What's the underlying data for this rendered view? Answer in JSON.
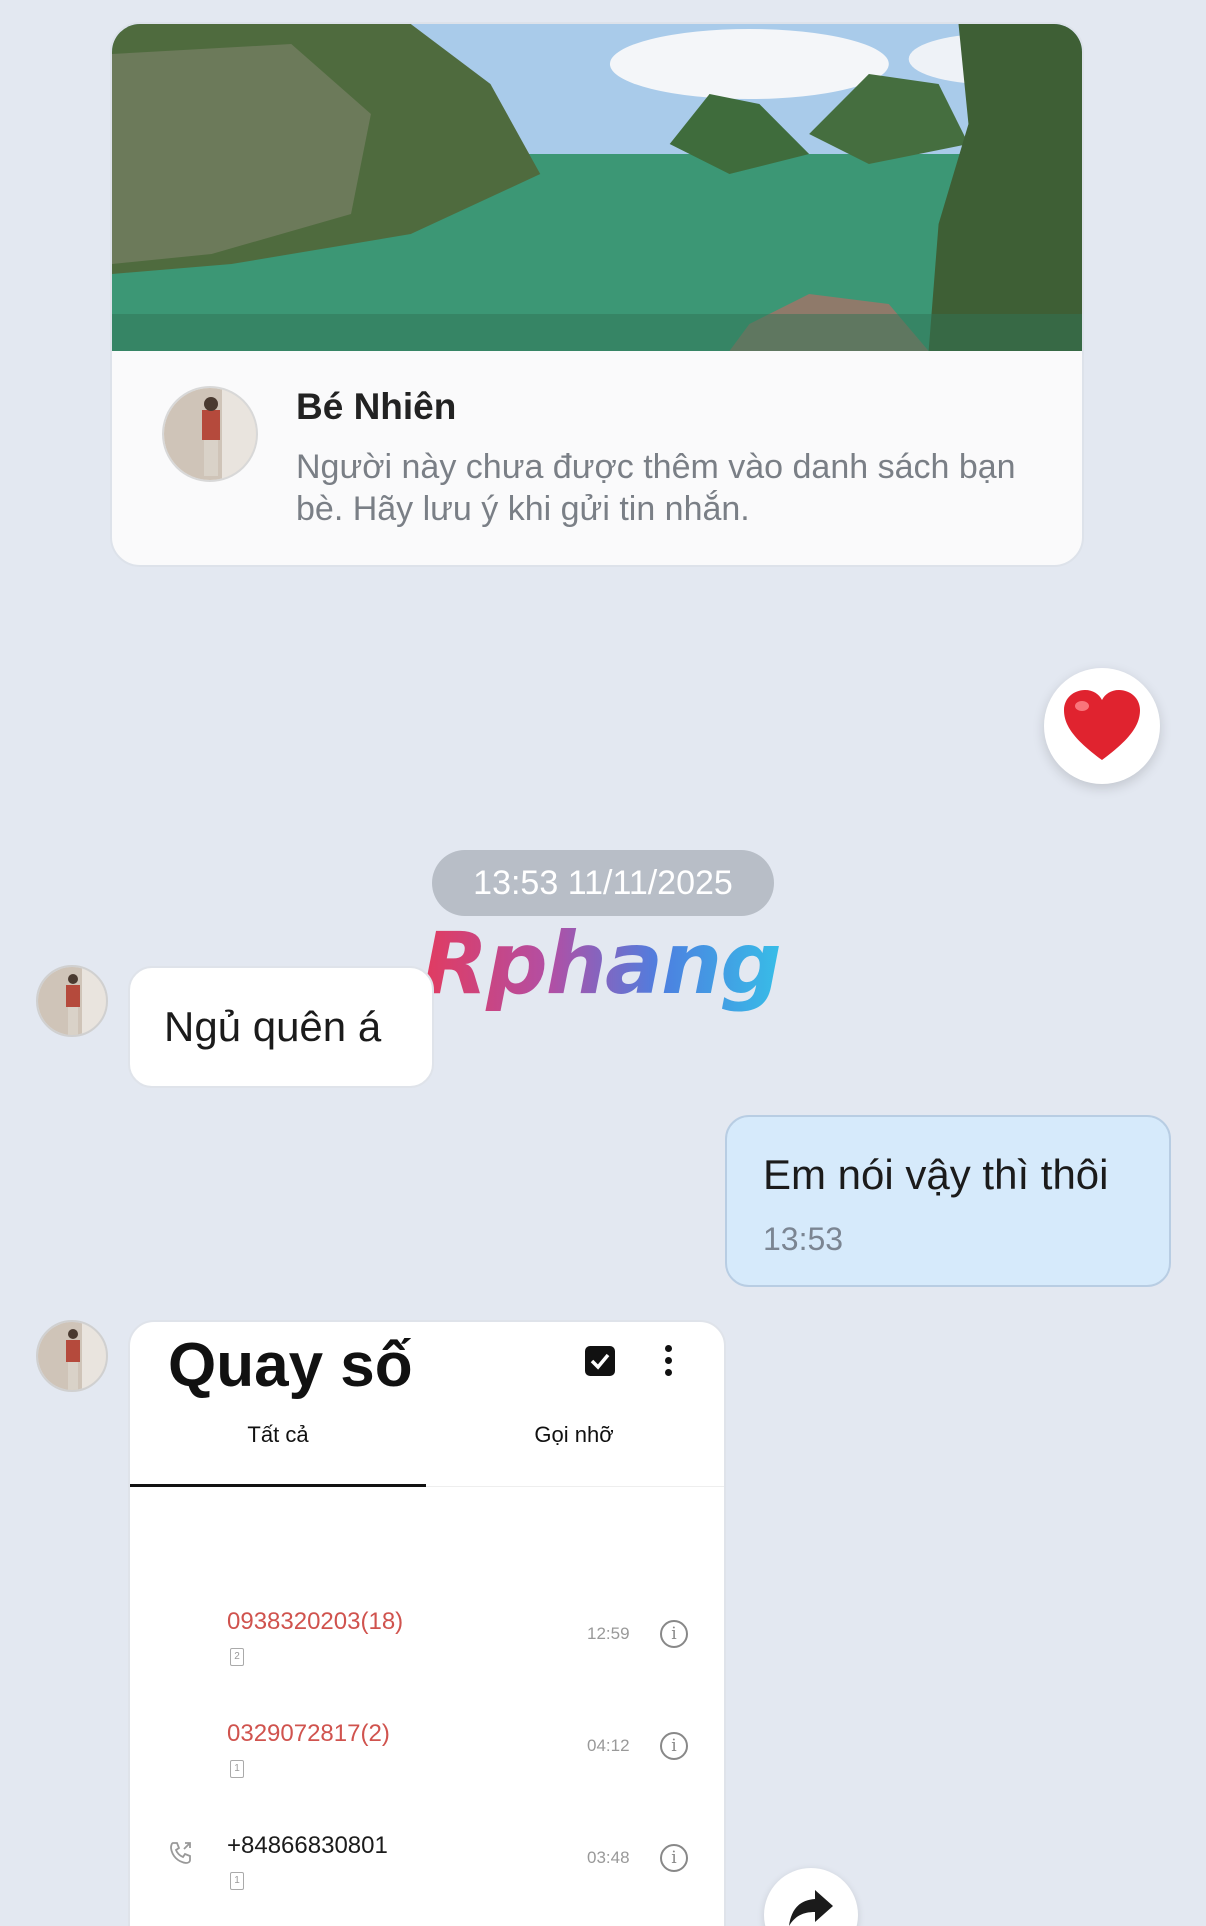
{
  "profile_card": {
    "name": "Bé Nhiên",
    "note": "Người này chưa được thêm vào danh sách bạn bè. Hãy lưu ý khi gửi tin nhắn."
  },
  "reaction": {
    "icon": "heart-icon",
    "color": "#e0232f"
  },
  "time_divider": "13:53 11/11/2025",
  "watermark": "Rphang",
  "messages": [
    {
      "direction": "incoming",
      "text": "Ngủ quên á"
    },
    {
      "direction": "outgoing",
      "text": "Em nói vậy thì thôi",
      "time": "13:53"
    }
  ],
  "image_message": {
    "title": "Quay số",
    "tabs": [
      "Tất cả",
      "Gọi nhỡ"
    ],
    "calls": [
      {
        "number": "0938320203(18)",
        "time": "12:59",
        "sim": "2",
        "missed": true
      },
      {
        "number": "0329072817(2)",
        "time": "04:12",
        "sim": "1",
        "missed": true
      },
      {
        "number": "+84866830801",
        "time": "03:48",
        "sim": "1",
        "missed": false
      }
    ]
  },
  "colors": {
    "background": "#e3e8f1",
    "outgoing_bubble": "#d6eafb",
    "missed_call": "#d0534e"
  }
}
